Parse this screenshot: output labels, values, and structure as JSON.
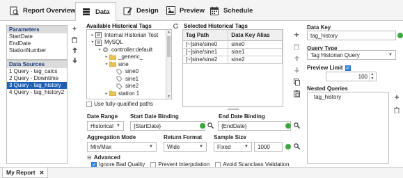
{
  "tabs": [
    {
      "label": "Report Overview",
      "icon": "report-overview-icon"
    },
    {
      "label": "Data",
      "icon": "data-icon"
    },
    {
      "label": "Design",
      "icon": "design-icon"
    },
    {
      "label": "Preview",
      "icon": "preview-icon"
    },
    {
      "label": "Schedule",
      "icon": "schedule-icon"
    }
  ],
  "parameters": {
    "header": "Parameters",
    "items": [
      "StartDate",
      "EndDate",
      "StationNumber"
    ]
  },
  "data_sources": {
    "header": "Data Sources",
    "items": [
      "1 Query - tag_calcs",
      "2 Query - Downtime",
      "3 Query - tag_history",
      "4 Query - tag_history2"
    ],
    "selected_index": 2
  },
  "tag_browser": {
    "header": "Available Historical Tags",
    "tree": [
      {
        "label": "Internal Historian Test",
        "level": 0,
        "toggle": "▸",
        "icon": "database-icon"
      },
      {
        "label": "MySQL",
        "level": 0,
        "toggle": "▾",
        "icon": "database-icon"
      },
      {
        "label": "controller:default",
        "level": 1,
        "toggle": "▾",
        "icon": "controller-icon"
      },
      {
        "label": "_generic_",
        "level": 2,
        "toggle": "▸",
        "icon": "folder-icon"
      },
      {
        "label": "sine",
        "level": 2,
        "toggle": "▾",
        "icon": "folder-icon"
      },
      {
        "label": "sine0",
        "level": 3,
        "toggle": "",
        "icon": "tag-icon"
      },
      {
        "label": "sine1",
        "level": 3,
        "toggle": "",
        "icon": "tag-icon"
      },
      {
        "label": "sine2",
        "level": 3,
        "toggle": "",
        "icon": "tag-icon"
      },
      {
        "label": "station 1",
        "level": 2,
        "toggle": "▸",
        "icon": "folder-icon"
      }
    ],
    "fully_qualified_label": "Use fully-qualified paths"
  },
  "selected_tags": {
    "header": "Selected Historical Tags",
    "columns": [
      "Tag Path",
      "Data Key Alias"
    ],
    "rows": [
      [
        "[~]sine/sine0",
        "sine0"
      ],
      [
        "[~]sine/sine1",
        "sine1"
      ],
      [
        "[~]sine/sine2",
        "sine2"
      ]
    ]
  },
  "date_range": {
    "label": "Date Range",
    "value": "Historical"
  },
  "start_date": {
    "label": "Start Date Binding",
    "value": "{StartDate}"
  },
  "end_date": {
    "label": "End Date Binding",
    "value": "{EndDate}"
  },
  "aggregation": {
    "label": "Aggregation Mode",
    "value": "Min/Max"
  },
  "return_format": {
    "label": "Return Format",
    "value": "Wide"
  },
  "sample_size": {
    "label": "Sample Size",
    "value": "Fixed",
    "count": "1000"
  },
  "advanced": {
    "label": "Advanced",
    "ignore_bad_quality": "Ignore Bad Quality",
    "prevent_interpolation": "Prevent Interpolation",
    "avoid_scanclass": "Avoid Scanclass Validation"
  },
  "data_key": {
    "label": "Data Key",
    "value": "tag_history"
  },
  "query_type": {
    "label": "Query Type",
    "value": "Tag Historian Query"
  },
  "preview_limit": {
    "label": "Preview Limit",
    "value": "100"
  },
  "nested_queries": {
    "label": "Nested Queries",
    "items": [
      "tag_history"
    ]
  },
  "bottom_tab": {
    "label": "My Report",
    "close": "✕"
  },
  "colors": {
    "accent": "#1e5fb4",
    "ok": "#3aa83a",
    "header_text": "#1a3d7a"
  }
}
